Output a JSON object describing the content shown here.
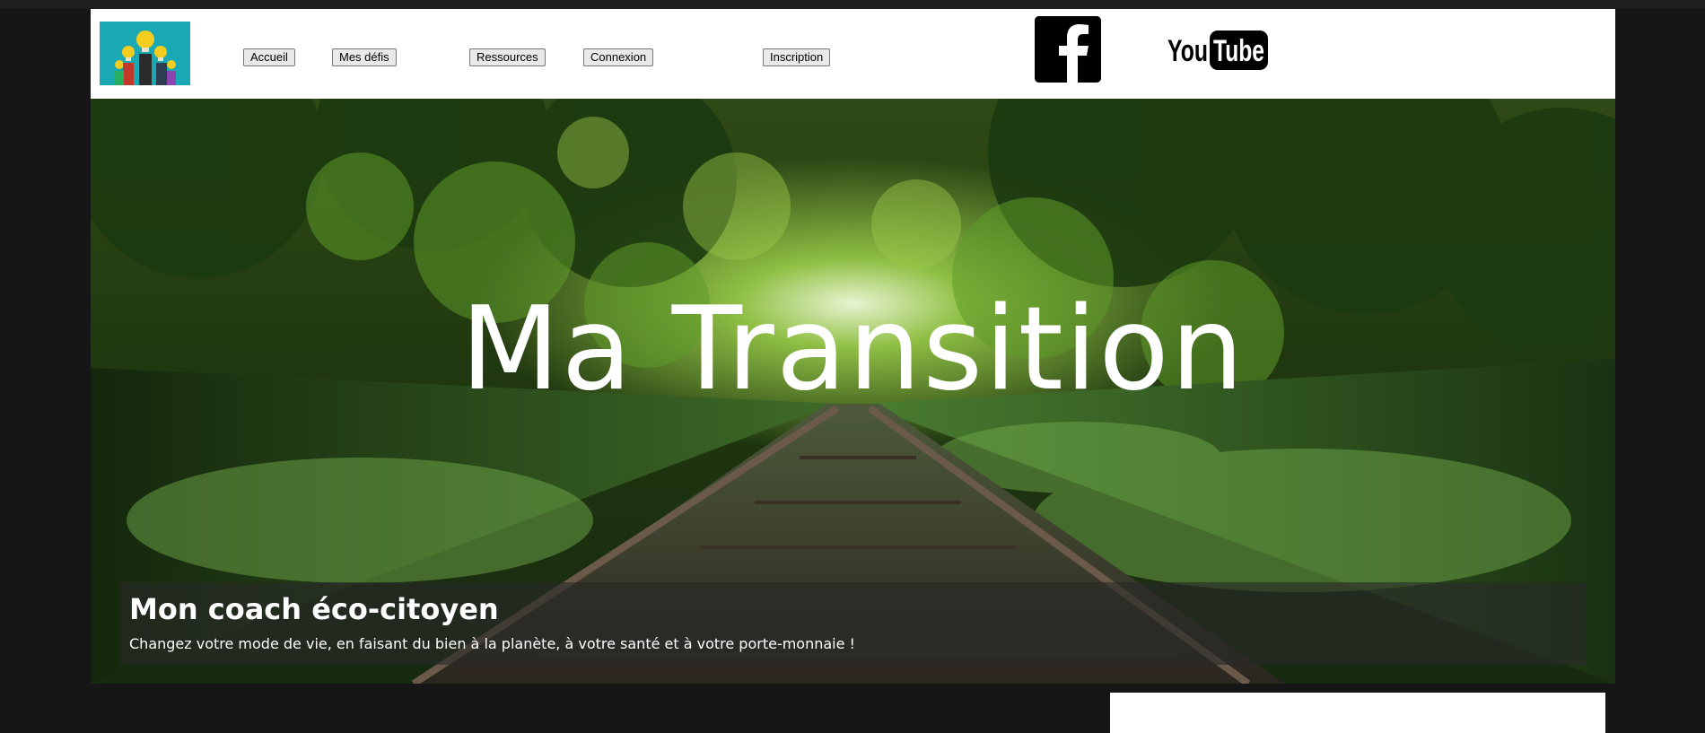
{
  "nav": {
    "buttons": [
      {
        "label": "Accueil"
      },
      {
        "label": "Mes défis"
      },
      {
        "label": "Ressources"
      },
      {
        "label": "Connexion"
      },
      {
        "label": "Inscription"
      }
    ]
  },
  "social": {
    "facebook_icon": "facebook-icon",
    "youtube": {
      "you": "You",
      "tube": "Tube"
    }
  },
  "hero": {
    "title": "Ma Transition",
    "caption_title": "Mon coach éco-citoyen",
    "caption_text": "Changez votre mode de vie, en faisant du bien à la planète, à votre santé et à votre porte-monnaie !"
  },
  "colors": {
    "page_bg": "#161616",
    "header_bg": "#ffffff",
    "logo_bg": "#19a8b4",
    "bulb": "#f2cc1f"
  }
}
